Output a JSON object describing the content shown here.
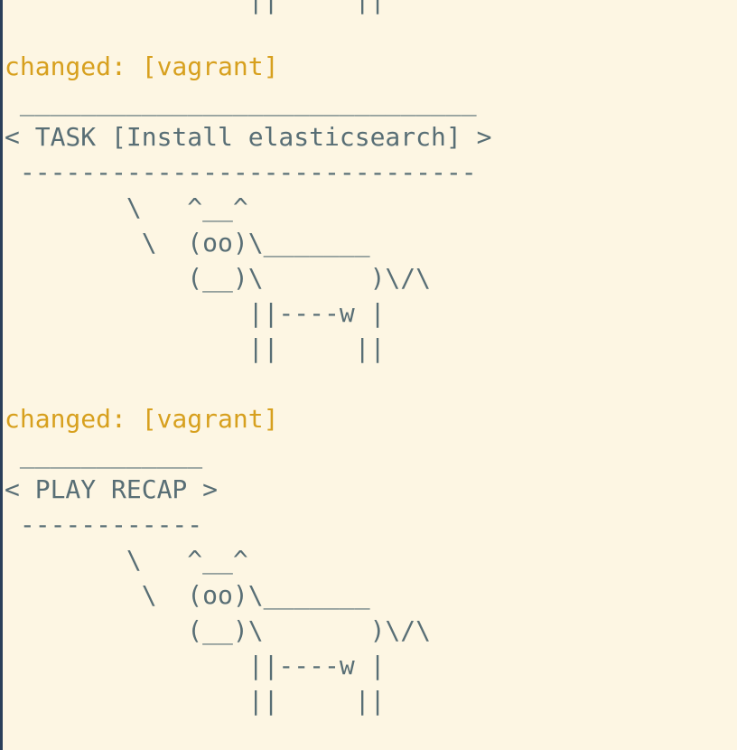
{
  "terminal": {
    "colors": {
      "background": "#fdf6e3",
      "text": "#586e75",
      "changed": "#d7a01e"
    },
    "lines": [
      {
        "kind": "cow",
        "text": "                ||     ||"
      },
      {
        "kind": "blank",
        "text": ""
      },
      {
        "kind": "changed",
        "text": "changed: [vagrant]"
      },
      {
        "kind": "cow",
        "text": " ______________________________"
      },
      {
        "kind": "cow",
        "text": "< TASK [Install elasticsearch] >"
      },
      {
        "kind": "cow",
        "text": " ------------------------------"
      },
      {
        "kind": "cow",
        "text": "        \\   ^__^"
      },
      {
        "kind": "cow",
        "text": "         \\  (oo)\\_______"
      },
      {
        "kind": "cow",
        "text": "            (__)\\       )\\/\\"
      },
      {
        "kind": "cow",
        "text": "                ||----w |"
      },
      {
        "kind": "cow",
        "text": "                ||     ||"
      },
      {
        "kind": "blank",
        "text": ""
      },
      {
        "kind": "changed",
        "text": "changed: [vagrant]"
      },
      {
        "kind": "cow",
        "text": " ____________"
      },
      {
        "kind": "cow",
        "text": "< PLAY RECAP >"
      },
      {
        "kind": "cow",
        "text": " ------------"
      },
      {
        "kind": "cow",
        "text": "        \\   ^__^"
      },
      {
        "kind": "cow",
        "text": "         \\  (oo)\\_______"
      },
      {
        "kind": "cow",
        "text": "            (__)\\       )\\/\\"
      },
      {
        "kind": "cow",
        "text": "                ||----w |"
      },
      {
        "kind": "cow",
        "text": "                ||     ||"
      }
    ]
  }
}
